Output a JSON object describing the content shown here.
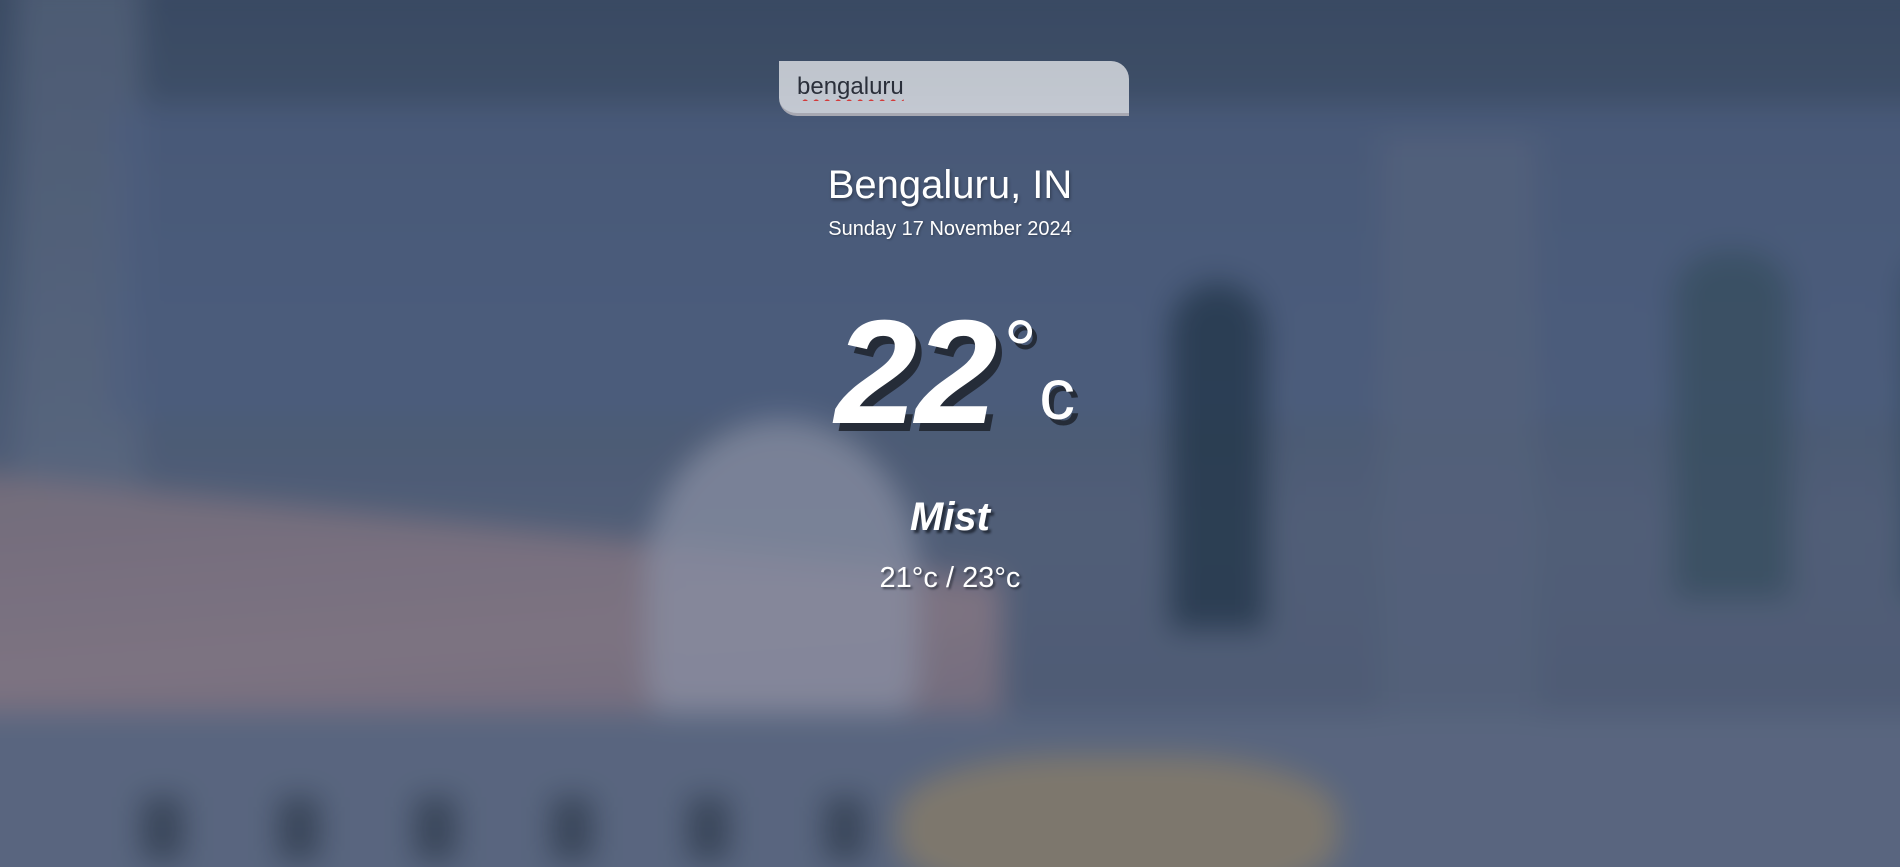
{
  "search": {
    "value": "bengaluru",
    "placeholder": ""
  },
  "location": {
    "name": "Bengaluru, IN",
    "date": "Sunday 17 November 2024"
  },
  "current": {
    "temperature": "22",
    "degree_symbol": "°",
    "unit": "c",
    "condition": "Mist",
    "hi_low": "21°c / 23°c"
  },
  "colors": {
    "text": "#ffffff",
    "search_background": "#d8dadf",
    "spellcheck_underline": "#d23a3a"
  }
}
